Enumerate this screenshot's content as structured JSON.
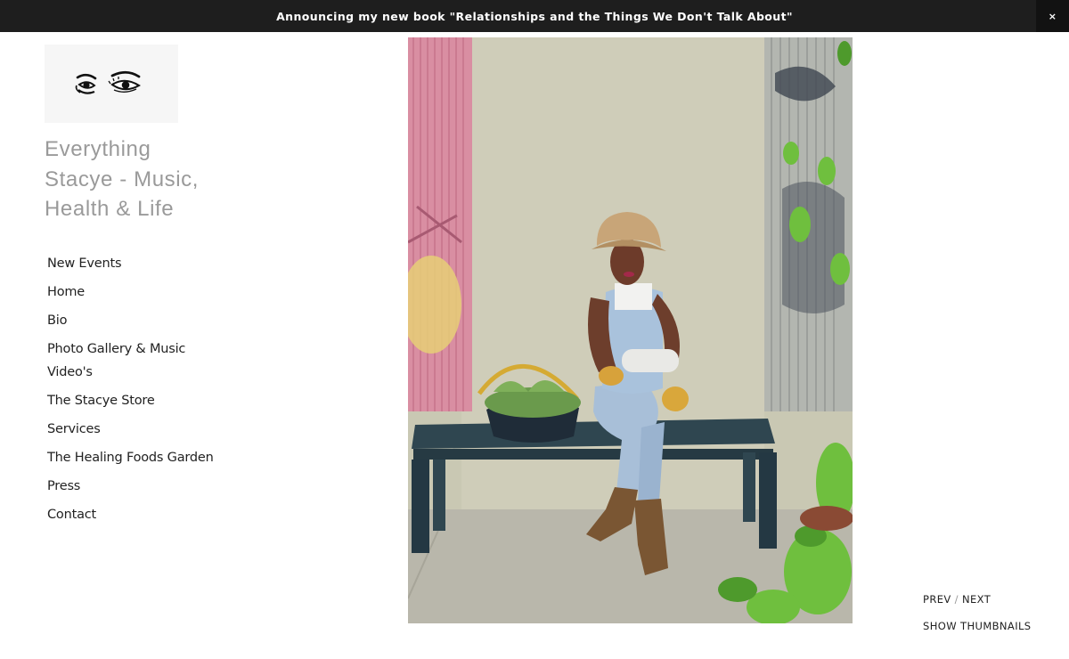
{
  "announcement": {
    "text": "Announcing my new book \"Relationships and the Things We Don't Talk About\"",
    "close_label": "×"
  },
  "site": {
    "title": "Everything Stacye - Music, Health & Life",
    "logo_icon": "eyes-logo-icon"
  },
  "nav": {
    "items": [
      {
        "label": "New Events"
      },
      {
        "label": "Home"
      },
      {
        "label": "Bio"
      },
      {
        "label": "Photo Gallery & Music Video's"
      },
      {
        "label": "The Stacye Store"
      },
      {
        "label": "Services"
      },
      {
        "label": "The Healing Foods Garden"
      },
      {
        "label": "Press"
      },
      {
        "label": "Contact"
      }
    ]
  },
  "gallery": {
    "prev_label": "PREV",
    "separator": "/",
    "next_label": "NEXT",
    "thumbnails_label": "SHOW THUMBNAILS"
  },
  "colors": {
    "announce_bg": "#1e1e1e",
    "title_gray": "#9a9a9a",
    "nav_text": "#222222"
  }
}
